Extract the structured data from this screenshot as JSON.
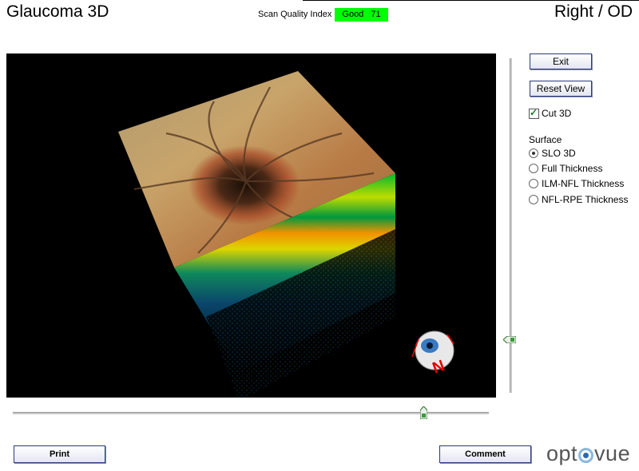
{
  "header": {
    "app_title": "Glaucoma 3D",
    "scan_quality_label": "Scan Quality Index",
    "scan_quality_value": "Good 71",
    "scan_quality_color": "#00ff00",
    "eye_side": "Right / OD"
  },
  "viewport": {
    "orientation_letter": "N",
    "orientation_icon": "eye-orientation-icon"
  },
  "controls": {
    "exit_label": "Exit",
    "reset_view_label": "Reset View",
    "cut3d_label": "Cut 3D",
    "cut3d_checked": true,
    "surface_label": "Surface",
    "surface_options": [
      {
        "label": "SLO 3D",
        "selected": true
      },
      {
        "label": "Full Thickness",
        "selected": false
      },
      {
        "label": "ILM-NFL Thickness",
        "selected": false
      },
      {
        "label": "NFL-RPE Thickness",
        "selected": false
      }
    ]
  },
  "footer": {
    "print_label": "Print",
    "comment_label": "Comment",
    "logo_text_left": "opt",
    "logo_text_right": "vue"
  }
}
